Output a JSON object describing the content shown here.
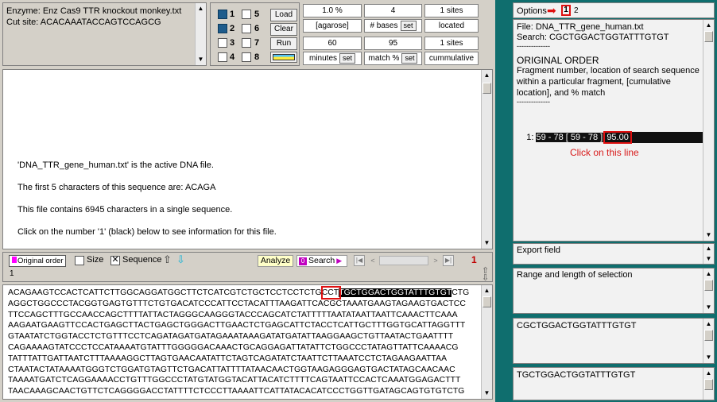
{
  "enzyme": {
    "name_line": "Enzyme: Enz Cas9 TTR knockout monkey.txt",
    "cut_site_line": "Cut site: ACACAAATACCAGTCCAGCG"
  },
  "lanes": {
    "numbers": [
      "1",
      "5",
      "2",
      "6",
      "3",
      "7",
      "4",
      "8"
    ],
    "load_label": "Load",
    "clear_label": "Clear",
    "run_label": "Run"
  },
  "params": {
    "agarose_value": "1.0 %",
    "agarose_label": "[agarose]",
    "bases_value": "4",
    "bases_label": "# bases",
    "sites_value": "1 sites",
    "sites_label": "located",
    "minutes_value": "60",
    "minutes_label": "minutes",
    "match_value": "95",
    "match_label": "match %",
    "cumm_sites_value": "1 sites",
    "cumm_label": "cummulative",
    "set_label": "set"
  },
  "messages": {
    "line1": "'DNA_TTR_gene_human.txt' is the active DNA file.",
    "line2": "The first 5 characters of this sequence are:  ACAGA",
    "line3": "This file contains 6945 characters in a single sequence.",
    "line4": "Click on the number '1' (black) below to see information for this file."
  },
  "toolbar": {
    "original_order": "Original order",
    "size": "Size",
    "sequence": "Sequence",
    "analyze": "Analyze",
    "search": "Search",
    "file_index": "1",
    "file_count": "1"
  },
  "sequence": {
    "line1_pre": "ACAGAAGTCCACTCATTCTTGGCAGGATGGCTTCTCATCGTCTGCTCCTCCTCTG",
    "line1_box": "CCT",
    "line1_hl": "TGCTGGACTGGTATTTGTGT",
    "line1_post": "CTG",
    "lines": [
      "AGGCTGGCCCTACGGTGAGTGTTTCTGTGACATCCCATTCCTACATTTAAGATTCACGCTAAATGAAGTAGAAGTGACTCC",
      "TTCCAGCTTTGCCAACCAGCTTTTATTACTAGGGCAAGGGTACCCAGCATCTATTTTTAATATAATTAATTCAAACTTCAAA",
      "AAGAATGAAGTTCCACTGAGCTTACTGAGCTGGGACTTGAACTCTGAGCATTCTACCTCATTGCTTTGGTGCATTAGGTTT",
      "GTAATATCTGGTACCTCTGTTTCCTCAGATAGATGATAGAAATAAAGATATGATATTAAGGAAGCTGTTAATACTGAATTTT",
      "CAGAAAAGTATCCCTCCATAAAATGTATTTGGGGGACAAACTGCAGGAGATTATATTCTGGCCCTATAGTTATTCAAAACG",
      "TATTTATTGATTAATCTTTAAAAGGCTTAGTGAACAATATTCTAGTCAGATATCTAATTCTTAAATCCTCTAGAAGAATTAA",
      "CTAATACTATAAAATGGGTCTGGATGTAGTTCTGACATTATTTTATAACAACTGGTAAGAGGGAGTGACTATAGCAACAAC",
      "TAAAATGATCTCAGGAAAACCTGTTTGGCCCTATGTATGGTACATTACATCTTTTCAGTAATTCCACTCAAATGGAGACTTT",
      "TAACAAAGCAACTGTTCTCAGGGGACCTATTTTCTCCCTTAAAATTCATTATACACATCCCTGGTTGATAGCAGTGTGTCTG"
    ]
  },
  "right": {
    "options_label": "Options",
    "tab1": "1",
    "tab2": "2",
    "file_line": "File:  DNA_TTR_gene_human.txt",
    "search_line": "Search:  CGCTGGACTGGTATTTGTGT",
    "dashes1": "--------------",
    "header": "ORIGINAL ORDER",
    "desc1": "Fragment number, location of search sequence",
    "desc2": "within a particular fragment, [cumulative",
    "desc3": "location], and % match",
    "dashes2": "--------------",
    "result_prefix": "1: ",
    "result_loc": "59 - 78 [ 59 - 78 ] ",
    "result_pct": "95.00",
    "hint": "Click on this line",
    "hint_color": "#d81b1b",
    "export_label": "Export field",
    "range_label": "Range and length of selection",
    "seq_selection": "CGCTGGACTGGTATTTGTGT",
    "seq_found": "TGCTGGACTGGTATTTGTGT"
  },
  "colors": {
    "teal_bg": "#0f6e6e",
    "accent_red": "#e01010",
    "original_order_swatch": "#ff00ff",
    "search_swatch": "#c000c0"
  }
}
